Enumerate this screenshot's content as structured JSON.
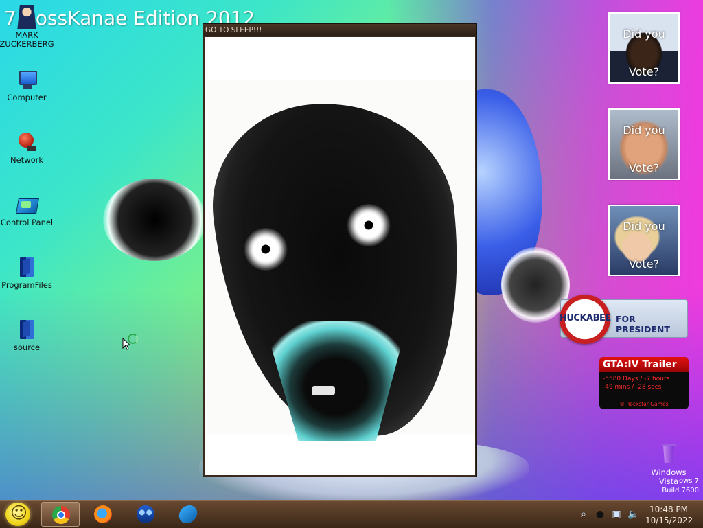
{
  "os_title": "7 BossKanae Edition 2012",
  "desktop_icons": [
    {
      "label": "MARK ZUCKERBERG",
      "icon": "person-icon"
    },
    {
      "label": "Computer",
      "icon": "computer-icon"
    },
    {
      "label": "Network",
      "icon": "network-icon"
    },
    {
      "label": "Control Panel",
      "icon": "control-panel-icon"
    },
    {
      "label": "ProgramFiles",
      "icon": "folder-icon"
    },
    {
      "label": "source",
      "icon": "folder-icon"
    },
    {
      "label": "Windows Vista",
      "icon": "recycle-bin-icon"
    }
  ],
  "window": {
    "title": "GO TO SLEEP!!!"
  },
  "gadgets": {
    "vote": [
      {
        "line1": "Did you",
        "line2": "Vote?"
      },
      {
        "line1": "Did you",
        "line2": "Vote?"
      },
      {
        "line1": "Did you",
        "line2": "Vote?"
      }
    ],
    "huckabee": {
      "name": "HUCKABEE",
      "slogan": "FOR PRESIDENT",
      "stars": "★★★★★★"
    },
    "gta": {
      "title": "GTA:IV Trailer",
      "countdown_line1": "-5580 Days / -7 hours",
      "countdown_line2": "-49 mins / -28 secs",
      "credit": "© Rockstar Games"
    }
  },
  "build_label": {
    "line1": "ows 7",
    "line2": "Build 7600"
  },
  "taskbar": {
    "buttons": [
      {
        "name": "chrome",
        "icon": "chrome-icon",
        "active": true
      },
      {
        "name": "firefox",
        "icon": "firefox-icon",
        "active": false
      },
      {
        "name": "people",
        "icon": "people-icon",
        "active": false
      },
      {
        "name": "control-panel",
        "icon": "control-panel-icon",
        "active": false
      }
    ],
    "tray_icons": [
      "search-icon",
      "circle-icon",
      "network-icon",
      "volume-icon"
    ],
    "time": "10:48 PM",
    "date": "10/15/2022"
  },
  "colors": {
    "taskbar": "#4e3522",
    "window_frame": "#3a2a1e",
    "gta_red": "#e41010",
    "huckabee_navy": "#1d2a6e"
  }
}
